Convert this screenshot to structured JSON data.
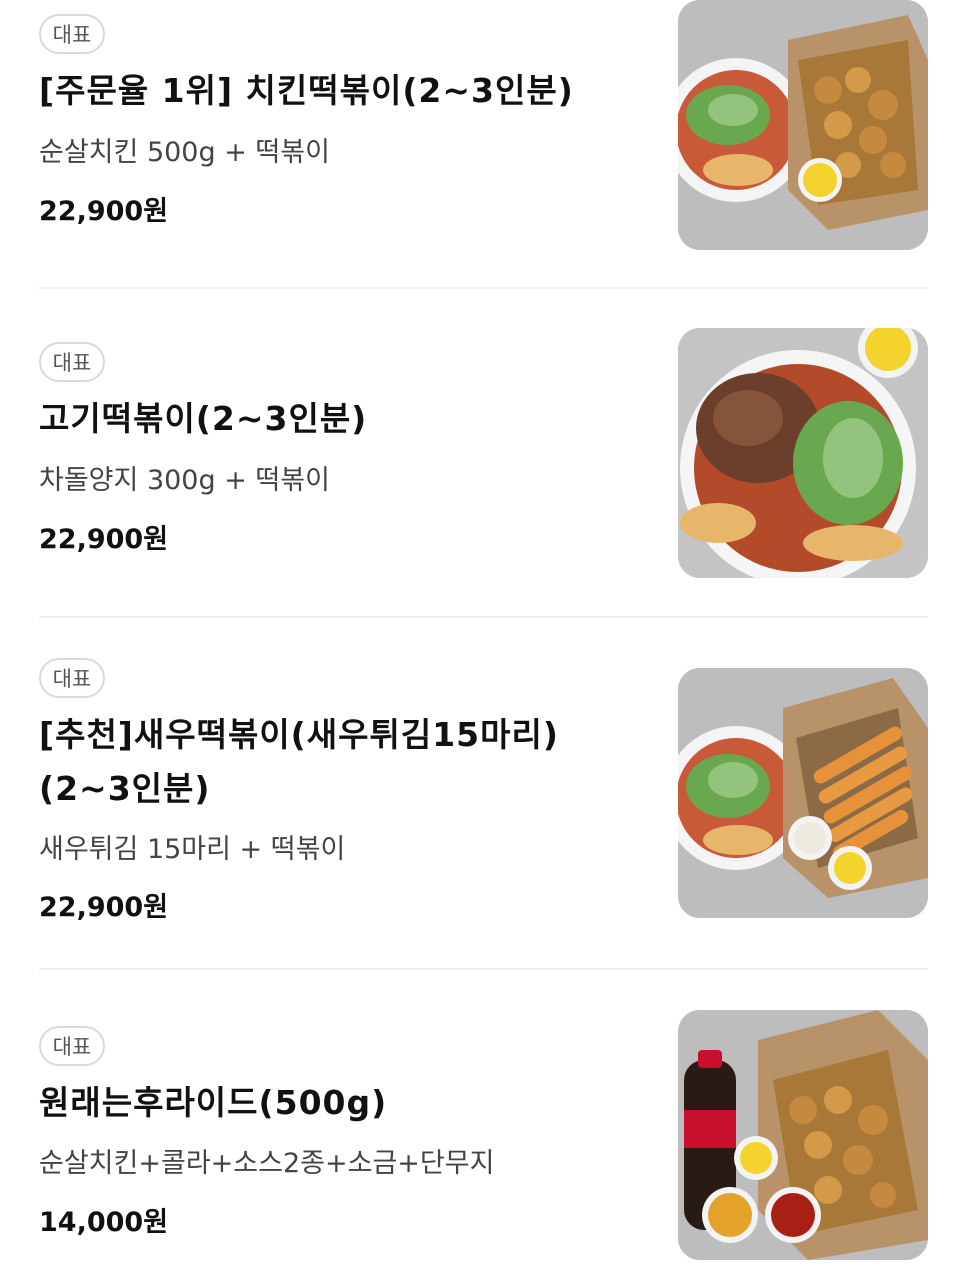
{
  "menu": {
    "items": [
      {
        "badge": "대표",
        "title": "[주문율 1위] 치킨떡볶이(2~3인분)",
        "description": "순살치킨 500g + 떡볶이",
        "price": "22,900원"
      },
      {
        "badge": "대표",
        "title": "고기떡볶이(2~3인분)",
        "description": "차돌양지 300g + 떡볶이",
        "price": "22,900원"
      },
      {
        "badge": "대표",
        "title": "[추천]새우떡볶이(새우튀김15마리)(2~3인분)",
        "description": "새우튀김 15마리 + 떡볶이",
        "price": "22,900원"
      },
      {
        "badge": "대표",
        "title": "원래는후라이드(500g)",
        "description": "순살치킨+콜라+소스2종+소금+단무지",
        "price": "14,000원"
      }
    ]
  }
}
